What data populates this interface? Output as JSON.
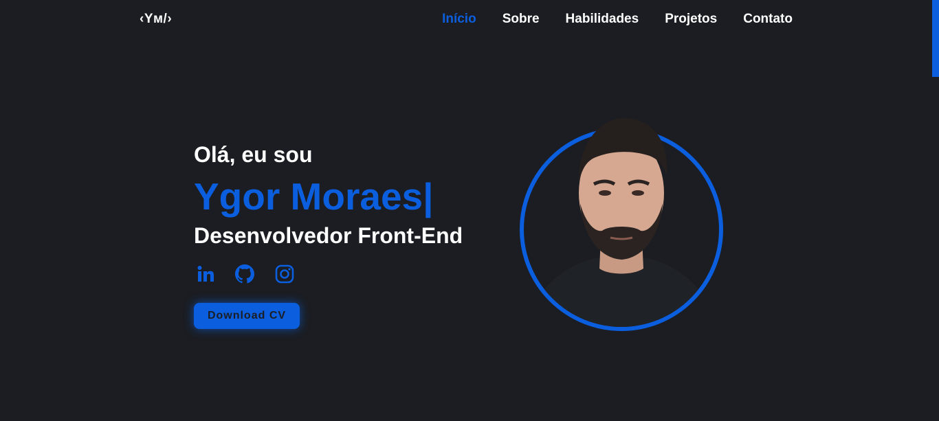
{
  "nav": {
    "logo": "‹Yм/›",
    "items": [
      {
        "label": "Início",
        "active": true
      },
      {
        "label": "Sobre",
        "active": false
      },
      {
        "label": "Habilidades",
        "active": false
      },
      {
        "label": "Projetos",
        "active": false
      },
      {
        "label": "Contato",
        "active": false
      }
    ]
  },
  "hero": {
    "greeting": "Olá, eu sou",
    "name": "Ygor Moraes|",
    "role": "Desenvolvedor Front-End",
    "socials": [
      "linkedin-icon",
      "github-icon",
      "instagram-icon"
    ],
    "cv_button": "Download CV"
  },
  "colors": {
    "background": "#1b1d22",
    "accent": "#0b5fdf",
    "text": "#ffffff"
  }
}
